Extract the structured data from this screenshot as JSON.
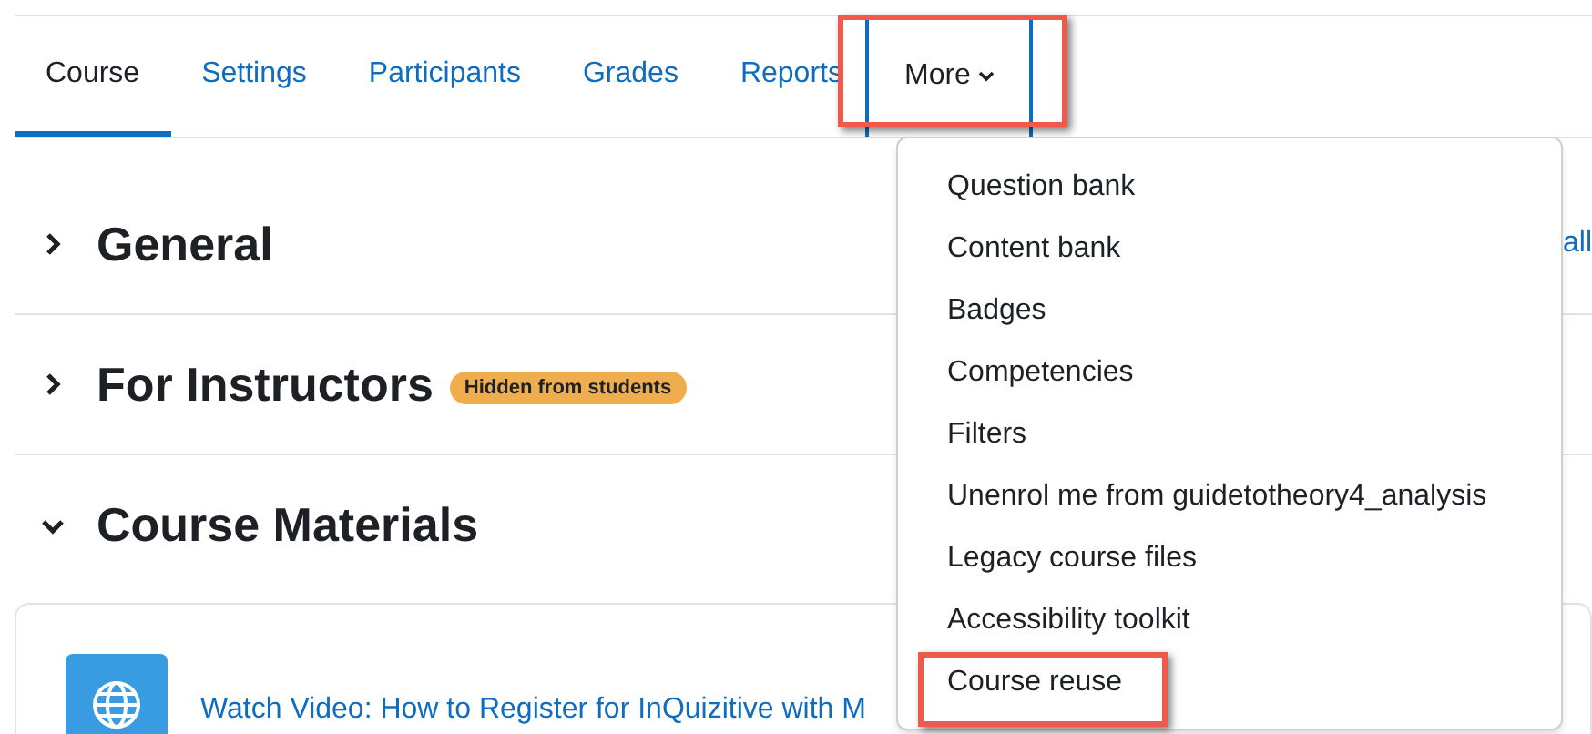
{
  "tabs": [
    {
      "label": "Course",
      "selected": true
    },
    {
      "label": "Settings",
      "selected": false
    },
    {
      "label": "Participants",
      "selected": false
    },
    {
      "label": "Grades",
      "selected": false
    },
    {
      "label": "Reports",
      "selected": false
    }
  ],
  "more_tab": {
    "label": "More",
    "open": true,
    "annotated": true
  },
  "sections": [
    {
      "title": "General",
      "expanded": false
    },
    {
      "title": "For Instructors",
      "expanded": false,
      "badge": "Hidden from students"
    },
    {
      "title": "Course Materials",
      "expanded": true
    }
  ],
  "collapse_link": "all",
  "activity": {
    "title": "Watch Video: How to Register for InQuizitive with M"
  },
  "more_menu": [
    {
      "label": "Question bank",
      "annotated": false
    },
    {
      "label": "Content bank",
      "annotated": false
    },
    {
      "label": "Badges",
      "annotated": false
    },
    {
      "label": "Competencies",
      "annotated": false
    },
    {
      "label": "Filters",
      "annotated": false
    },
    {
      "label": "Unenrol me from guidetotheory4_analysis",
      "annotated": false
    },
    {
      "label": "Legacy course files",
      "annotated": false
    },
    {
      "label": "Accessibility toolkit",
      "annotated": false
    },
    {
      "label": "Course reuse",
      "annotated": true
    }
  ]
}
